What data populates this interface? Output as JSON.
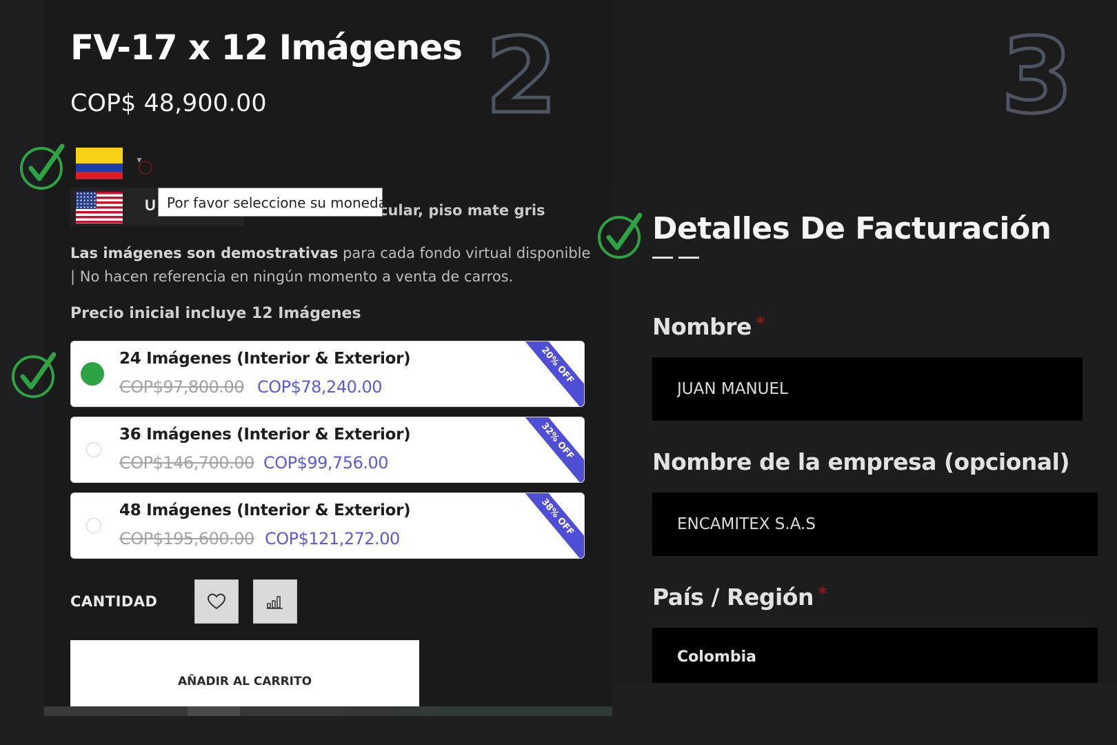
{
  "step_numbers": {
    "left": "2",
    "right": "3"
  },
  "product": {
    "title": "FV-17 x 12 Imágenes",
    "price": "COP$ 48,900.00",
    "subtitle_tail": "cular, piso mate gris",
    "description_bold": "Las imágenes son demostrativas",
    "description_rest": " para cada fondo virtual disponible | No hacen referencia en ningún momento a venta de carros.",
    "includes": "Precio inicial incluye 12 Imágenes"
  },
  "currency": {
    "selected_flag": "colombia-flag",
    "alt_flag": "usa-flag",
    "alt_label_start": "U",
    "tooltip": "Por favor seleccione su moneda"
  },
  "options": [
    {
      "title": "24 Imágenes (Interior & Exterior)",
      "old_price": "COP$97,800.00",
      "new_price": "COP$78,240.00",
      "badge": "20% OFF",
      "selected": true
    },
    {
      "title": "36 Imágenes (Interior & Exterior)",
      "old_price": "COP$146,700.00",
      "new_price": "COP$99,756.00",
      "badge": "32% OFF",
      "selected": false
    },
    {
      "title": "48 Imágenes (Interior & Exterior)",
      "old_price": "COP$195,600.00",
      "new_price": "COP$121,272.00",
      "badge": "38% OFF",
      "selected": false
    }
  ],
  "quantity_label": "CANTIDAD",
  "icons": {
    "wishlist": "heart-icon",
    "compare": "bar-chart-icon",
    "check": "check-circle-icon"
  },
  "add_to_cart_label": "AÑADIR AL CARRITO",
  "billing": {
    "title": "Detalles De Facturación",
    "first_name_label": "Nombre",
    "first_name_value": "JUAN MANUEL",
    "company_label": "Nombre de la empresa (opcional)",
    "company_value": "ENCAMITEX S.A.S",
    "country_label": "País / Región",
    "country_value": "Colombia",
    "required_mark": "*"
  },
  "colors": {
    "accent_green": "#2ea343",
    "price_blue": "#5a5ad9",
    "badge_blue": "#4f4fd6",
    "required_red": "#8a1a1a"
  }
}
